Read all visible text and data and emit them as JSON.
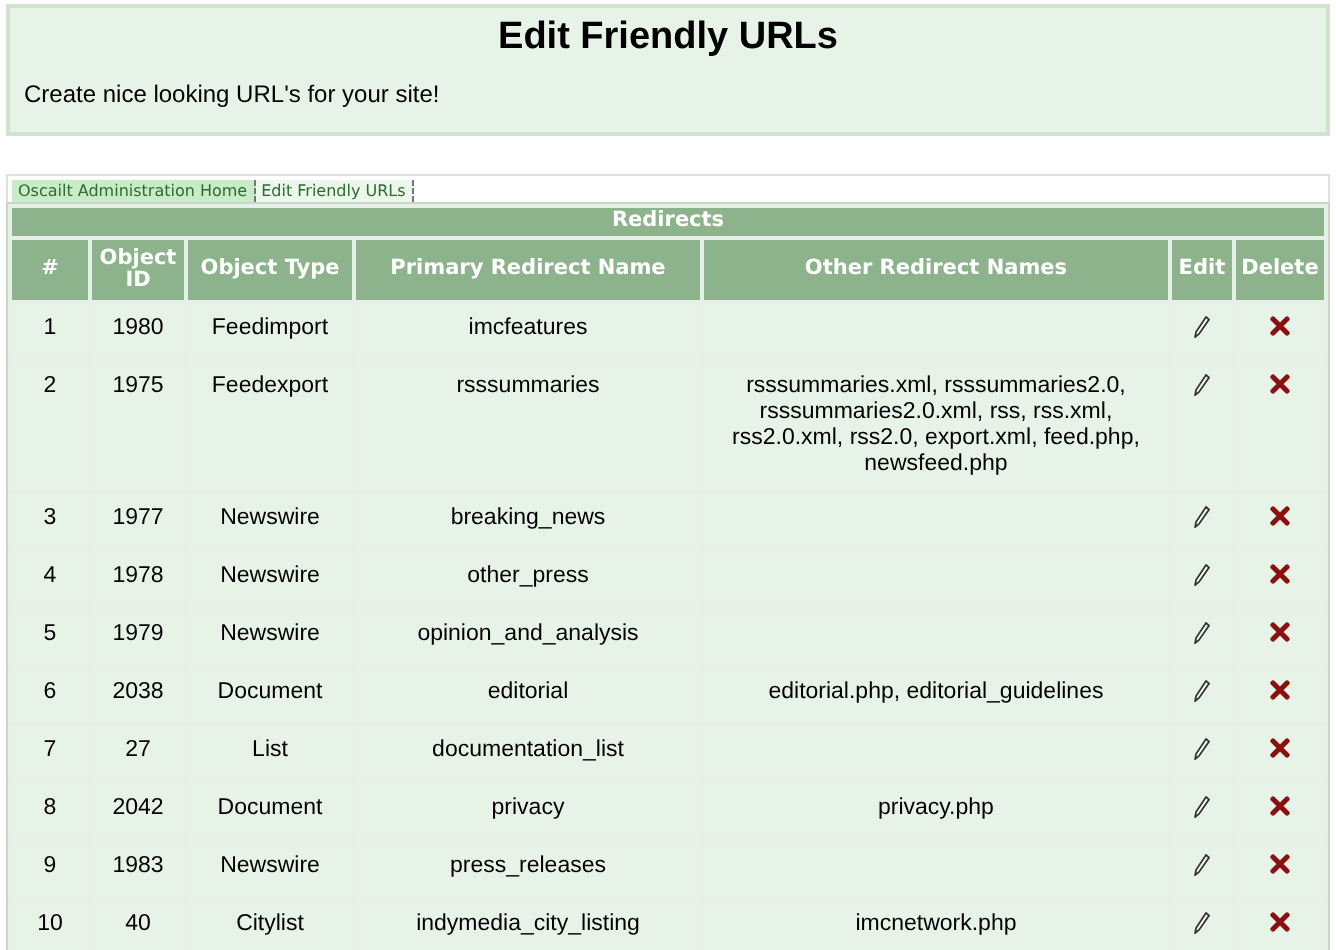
{
  "header": {
    "title": "Edit Friendly URLs",
    "subtitle": "Create nice looking URL's for your site!"
  },
  "breadcrumbs": [
    "Oscailt Administration Home",
    "Edit Friendly URLs"
  ],
  "table": {
    "caption": "Redirects",
    "columns": [
      "#",
      "Object ID",
      "Object Type",
      "Primary Redirect Name",
      "Other Redirect Names",
      "Edit",
      "Delete"
    ],
    "rows": [
      {
        "num": "1",
        "id": "1980",
        "type": "Feedimport",
        "primary": "imcfeatures",
        "other": ""
      },
      {
        "num": "2",
        "id": "1975",
        "type": "Feedexport",
        "primary": "rsssummaries",
        "other": "rsssummaries.xml, rsssummaries2.0, rsssummaries2.0.xml, rss, rss.xml, rss2.0.xml, rss2.0, export.xml, feed.php, newsfeed.php"
      },
      {
        "num": "3",
        "id": "1977",
        "type": "Newswire",
        "primary": "breaking_news",
        "other": ""
      },
      {
        "num": "4",
        "id": "1978",
        "type": "Newswire",
        "primary": "other_press",
        "other": ""
      },
      {
        "num": "5",
        "id": "1979",
        "type": "Newswire",
        "primary": "opinion_and_analysis",
        "other": ""
      },
      {
        "num": "6",
        "id": "2038",
        "type": "Document",
        "primary": "editorial",
        "other": "editorial.php, editorial_guidelines"
      },
      {
        "num": "7",
        "id": "27",
        "type": "List",
        "primary": "documentation_list",
        "other": ""
      },
      {
        "num": "8",
        "id": "2042",
        "type": "Document",
        "primary": "privacy",
        "other": "privacy.php"
      },
      {
        "num": "9",
        "id": "1983",
        "type": "Newswire",
        "primary": "press_releases",
        "other": ""
      },
      {
        "num": "10",
        "id": "40",
        "type": "Citylist",
        "primary": "indymedia_city_listing",
        "other": "imcnetwork.php"
      }
    ]
  }
}
